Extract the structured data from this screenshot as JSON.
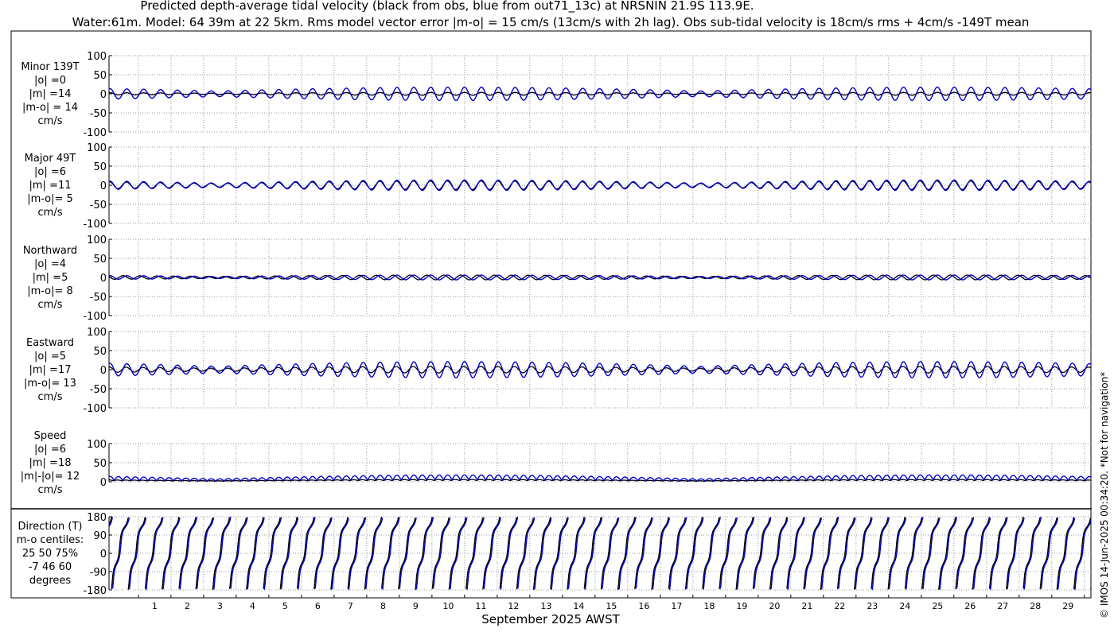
{
  "title_line1": "Predicted depth-average tidal velocity (black from obs, blue from out71_13c) at NRSNIN 21.9S 113.9E.",
  "title_line2": "Water:61m. Model: 64 39m at 22 5km. Rms model vector error |m-o| = 15 cm/s (13cm/s with 2h lag). Obs sub-tidal velocity is 18cm/s rms + 4cm/s -149T mean",
  "xlabel": "September 2025 AWST",
  "copyright": "© IMOS 14-Jun-2025 00:34:20. *Not for navigation*",
  "colors": {
    "obs": "#000000",
    "model": "#0000cc",
    "grid": "#999999"
  },
  "chart_data": {
    "type": "line",
    "x_unit": "day of September 2025",
    "x_range": [
      0.1,
      30.2
    ],
    "x_ticks": [
      "1",
      "2",
      "3",
      "4",
      "5",
      "6",
      "7",
      "8",
      "9",
      "10",
      "11",
      "12",
      "13",
      "14",
      "15",
      "16",
      "17",
      "18",
      "19",
      "20",
      "21",
      "22",
      "23",
      "24",
      "25",
      "26",
      "27",
      "28",
      "29"
    ],
    "grid": true,
    "series": [
      {
        "name": "obs",
        "color": "#000000"
      },
      {
        "name": "model",
        "color": "#0000cc"
      }
    ],
    "panels": [
      {
        "id": "minor",
        "label_lines": [
          "Minor 139T",
          "|o| =0",
          "|m| =14",
          "|m-o| = 14",
          "cm/s"
        ],
        "ylim": [
          -100,
          100
        ],
        "yticks": [
          "100",
          "50",
          "0",
          "-50",
          "-100"
        ],
        "obs_amp": 3,
        "model_amp": 14,
        "phase_lag": 0
      },
      {
        "id": "major",
        "label_lines": [
          "Major 49T",
          "|o| =6",
          "|m| =11",
          "|m-o|= 5",
          "cm/s"
        ],
        "ylim": [
          -100,
          100
        ],
        "yticks": [
          "100",
          "50",
          "0",
          "-50",
          "-100"
        ],
        "obs_amp": 9,
        "model_amp": 11,
        "phase_lag": 0.15
      },
      {
        "id": "northward",
        "label_lines": [
          "Northward",
          "|o| =4",
          "|m| =5",
          "|m-o|= 8",
          "cm/s"
        ],
        "ylim": [
          -100,
          100
        ],
        "yticks": [
          "100",
          "50",
          "0",
          "-50",
          "-100"
        ],
        "obs_amp": 5,
        "model_amp": 5,
        "phase_lag": 1.4
      },
      {
        "id": "eastward",
        "label_lines": [
          "Eastward",
          "|o| =5",
          "|m| =17",
          "|m-o|= 13",
          "cm/s"
        ],
        "ylim": [
          -100,
          100
        ],
        "yticks": [
          "100",
          "50",
          "0",
          "-50",
          "-100"
        ],
        "obs_amp": 7,
        "model_amp": 17,
        "phase_lag": 0.25
      },
      {
        "id": "speed",
        "label_lines": [
          "Speed",
          "|o| =6",
          "|m| =18",
          "|m|-|o|= 12",
          "cm/s"
        ],
        "ylim": [
          0,
          100
        ],
        "yticks": [
          "100",
          "50",
          "0"
        ],
        "obs_amp": 6,
        "model_amp": 18,
        "phase_lag": 0
      },
      {
        "id": "direction",
        "label_lines": [
          "Direction (T)",
          "m-o centiles:",
          "25  50  75%",
          "-7  46  60",
          "degrees"
        ],
        "ylim": [
          -180,
          180
        ],
        "yticks": [
          "180",
          "90",
          "0",
          "-90",
          "-180"
        ],
        "obs_amp": 0,
        "model_amp": 0,
        "phase_lag": 0
      }
    ]
  }
}
